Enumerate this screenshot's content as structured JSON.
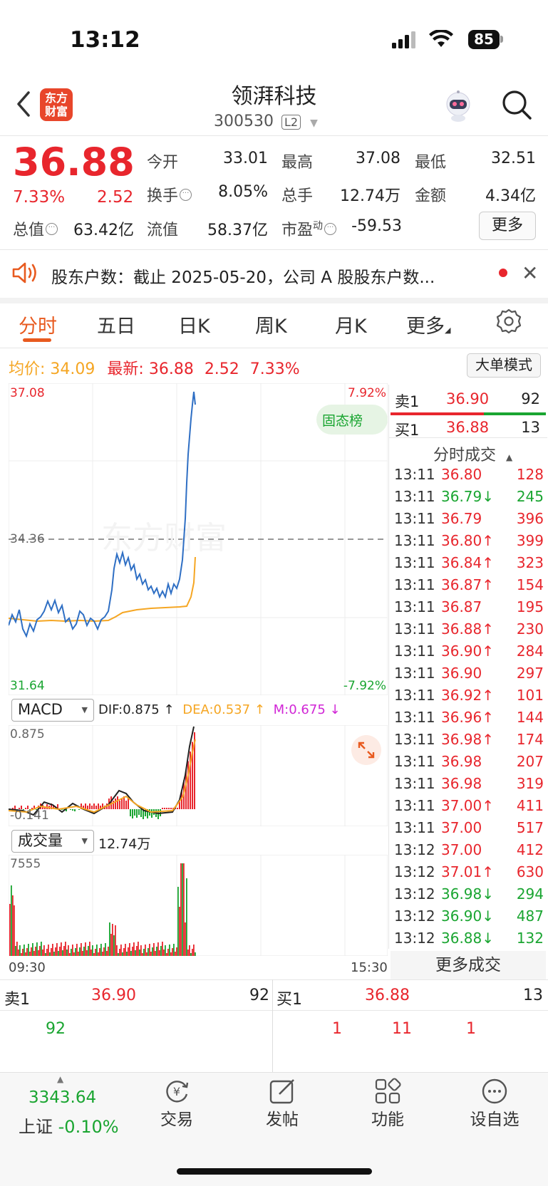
{
  "status_bar": {
    "time": "13:12",
    "battery": "85"
  },
  "header": {
    "logo_text": "东方财富",
    "stock_name": "领湃科技",
    "stock_code": "300530",
    "level_badge": "L2"
  },
  "quote": {
    "price": "36.88",
    "pct_change": "7.33%",
    "abs_change": "2.52",
    "fields": [
      {
        "label": "今开",
        "value": "33.01",
        "color": "green"
      },
      {
        "label": "最高",
        "value": "37.08",
        "color": "red"
      },
      {
        "label": "最低",
        "value": "32.51",
        "color": "green"
      },
      {
        "label": "换手",
        "value": "8.05%",
        "color": "normal"
      },
      {
        "label": "总手",
        "value": "12.74万",
        "color": "normal"
      },
      {
        "label": "金额",
        "value": "4.34亿",
        "color": "normal"
      },
      {
        "label": "总值",
        "value": "63.42亿",
        "color": "normal"
      },
      {
        "label": "流值",
        "value": "58.37亿",
        "color": "normal"
      },
      {
        "label": "市盈",
        "value": "-59.53",
        "color": "normal"
      }
    ],
    "pe_superscript": "动",
    "more_label": "更多"
  },
  "notice": {
    "text": "股东户数：截止 2025-05-20，公司 A 股股东户数..."
  },
  "tabs": [
    "分时",
    "五日",
    "日K",
    "周K",
    "月K",
    "更多"
  ],
  "chart_info": {
    "avg_label": "均价:",
    "avg_value": "34.09",
    "latest_label": "最新:",
    "latest_value": "36.88",
    "latest_change": "2.52",
    "latest_pct": "7.33%",
    "big_order_label": "大单模式",
    "price_top": "37.08",
    "price_mid": "34.36",
    "price_bottom": "31.64",
    "pct_top": "7.92%",
    "pct_bottom": "-7.92%",
    "badge": "固态榜",
    "watermark": "东方财富",
    "time_start": "09:30",
    "time_end": "15:30"
  },
  "macd": {
    "label": "MACD",
    "dif": "DIF:0.875 ↑",
    "dea": "DEA:0.537 ↑",
    "m": "M:0.675 ↓",
    "top": "0.875",
    "bottom": "-0.141"
  },
  "volume": {
    "label": "成交量",
    "total": "12.74万",
    "top": "7555"
  },
  "order_book": {
    "sell1": {
      "label": "卖1",
      "price": "36.90",
      "vol": "92"
    },
    "buy1": {
      "label": "买1",
      "price": "36.88",
      "vol": "13"
    },
    "ticks_header": "分时成交",
    "more_trades": "更多成交",
    "ticks": [
      {
        "time": "13:11",
        "price": "36.80",
        "arrow": "",
        "vol": "128",
        "dir": "red"
      },
      {
        "time": "13:11",
        "price": "36.79",
        "arrow": "↓",
        "vol": "245",
        "dir": "green"
      },
      {
        "time": "13:11",
        "price": "36.79",
        "arrow": "",
        "vol": "396",
        "dir": "red"
      },
      {
        "time": "13:11",
        "price": "36.80",
        "arrow": "↑",
        "vol": "399",
        "dir": "red"
      },
      {
        "time": "13:11",
        "price": "36.84",
        "arrow": "↑",
        "vol": "323",
        "dir": "red"
      },
      {
        "time": "13:11",
        "price": "36.87",
        "arrow": "↑",
        "vol": "154",
        "dir": "red"
      },
      {
        "time": "13:11",
        "price": "36.87",
        "arrow": "",
        "vol": "195",
        "dir": "red"
      },
      {
        "time": "13:11",
        "price": "36.88",
        "arrow": "↑",
        "vol": "230",
        "dir": "red"
      },
      {
        "time": "13:11",
        "price": "36.90",
        "arrow": "↑",
        "vol": "284",
        "dir": "red"
      },
      {
        "time": "13:11",
        "price": "36.90",
        "arrow": "",
        "vol": "297",
        "dir": "red"
      },
      {
        "time": "13:11",
        "price": "36.92",
        "arrow": "↑",
        "vol": "101",
        "dir": "red"
      },
      {
        "time": "13:11",
        "price": "36.96",
        "arrow": "↑",
        "vol": "144",
        "dir": "red"
      },
      {
        "time": "13:11",
        "price": "36.98",
        "arrow": "↑",
        "vol": "174",
        "dir": "red"
      },
      {
        "time": "13:11",
        "price": "36.98",
        "arrow": "",
        "vol": "207",
        "dir": "red"
      },
      {
        "time": "13:11",
        "price": "36.98",
        "arrow": "",
        "vol": "319",
        "dir": "red"
      },
      {
        "time": "13:11",
        "price": "37.00",
        "arrow": "↑",
        "vol": "411",
        "dir": "red"
      },
      {
        "time": "13:11",
        "price": "37.00",
        "arrow": "",
        "vol": "517",
        "dir": "red"
      },
      {
        "time": "13:12",
        "price": "37.00",
        "arrow": "",
        "vol": "412",
        "dir": "red"
      },
      {
        "time": "13:12",
        "price": "37.01",
        "arrow": "↑",
        "vol": "630",
        "dir": "red"
      },
      {
        "time": "13:12",
        "price": "36.98",
        "arrow": "↓",
        "vol": "294",
        "dir": "green"
      },
      {
        "time": "13:12",
        "price": "36.90",
        "arrow": "↓",
        "vol": "487",
        "dir": "green"
      },
      {
        "time": "13:12",
        "price": "36.88",
        "arrow": "↓",
        "vol": "132",
        "dir": "green"
      }
    ]
  },
  "queue": {
    "sell_label": "卖1",
    "sell_price": "36.90",
    "sell_vol": "92",
    "buy_label": "买1",
    "buy_price": "36.88",
    "buy_vol": "13",
    "sell_queue": [
      "92"
    ],
    "buy_queue": [
      "1",
      "11",
      "1"
    ]
  },
  "bottom_nav": {
    "index_value": "3343.64",
    "index_name": "上证",
    "index_change": "-0.10%",
    "items": [
      {
        "label": "交易",
        "icon": "trade-icon"
      },
      {
        "label": "发帖",
        "icon": "post-icon"
      },
      {
        "label": "功能",
        "icon": "function-icon"
      },
      {
        "label": "设自选",
        "icon": "watchlist-icon"
      }
    ]
  },
  "colors": {
    "up": "#e8262d",
    "down": "#1aa531",
    "accent": "#e85a1f",
    "avg_line": "#f5a623",
    "price_line": "#2f6fc4"
  }
}
